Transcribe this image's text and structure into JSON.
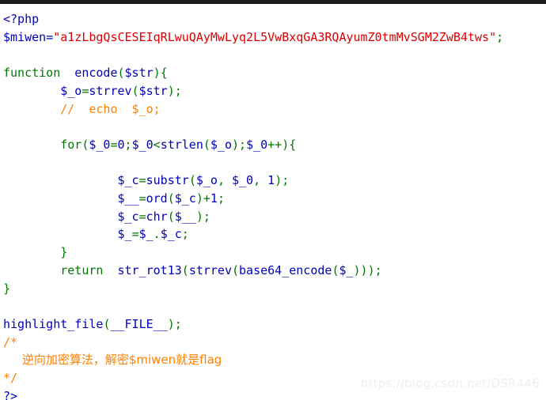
{
  "window": {
    "background_color": "#ffffff",
    "top_strip_color": "#1c1b1c"
  },
  "syntax_colors": {
    "default": "#0000bb",
    "keyword": "#007700",
    "string": "#dd0000",
    "comment": "#ff8000"
  },
  "code": {
    "language": "php",
    "line_01_open_tag": "<?php",
    "line_02_var": "$miwen=",
    "line_02_string": "\"a1zLbgQsCESEIqRLwuQAyMwLyq2L5VwBxqGA3RQAyumZ0tmMvSGM2ZwB4tws\"",
    "line_02_semi": ";",
    "line_04_kw_function": "function",
    "line_04_name": "  encode",
    "line_04_paren_open": "(",
    "line_04_param": "$str",
    "line_04_paren_close": ")",
    "line_04_brace": "{",
    "line_05_var": "        $_o",
    "line_05_eq": "=",
    "line_05_call": "strrev",
    "line_05_paren_open": "(",
    "line_05_arg": "$str",
    "line_05_tail": ");",
    "line_06_comment": "        //  echo  $_o;",
    "line_08_kw_for": "        for",
    "line_08_paren_open": "(",
    "line_08_v1": "$_0",
    "line_08_eq1": "=",
    "line_08_zero": "0",
    "line_08_semi1": ";",
    "line_08_v2": "$_0",
    "line_08_lt": "<",
    "line_08_strlen": "strlen",
    "line_08_p2": "(",
    "line_08_v3": "$_o",
    "line_08_p3": ");",
    "line_08_v4": "$_0",
    "line_08_inc": "++",
    "line_08_p4": ")",
    "line_08_brace": "{",
    "line_10_var": "                $_c",
    "line_10_eq": "=",
    "line_10_call": "substr",
    "line_10_p": "(",
    "line_10_a1": "$_o",
    "line_10_c1": ",",
    "line_10_a2": " $_0",
    "line_10_c2": ",",
    "line_10_num": " 1",
    "line_10_tail": ");",
    "line_11_var": "                $__",
    "line_11_eq": "=",
    "line_11_call": "ord",
    "line_11_p": "(",
    "line_11_a1": "$_c",
    "line_11_pc": ")",
    "line_11_plus": "+",
    "line_11_num": "1",
    "line_11_semi": ";",
    "line_12_var": "                $_c",
    "line_12_eq": "=",
    "line_12_call": "chr",
    "line_12_p": "(",
    "line_12_a1": "$__",
    "line_12_tail": ");",
    "line_13_var": "                $_",
    "line_13_eq": "=",
    "line_13_a1": "$_",
    "line_13_dot": ".",
    "line_13_a2": "$_c",
    "line_13_semi": ";",
    "line_14_brace_close": "        }",
    "line_15_kw_return": "        return",
    "line_15_call1": "  str_rot13",
    "line_15_p1": "(",
    "line_15_call2": "strrev",
    "line_15_p2": "(",
    "line_15_call3": "base64_encode",
    "line_15_p3": "(",
    "line_15_arg": "$_",
    "line_15_tail": ")));",
    "line_16_brace_close": "}",
    "line_18_call": "highlight_file",
    "line_18_p": "(",
    "line_18_const": "__FILE__",
    "line_18_tail": ");",
    "line_19_comment_open": "/*",
    "line_20_comment_cjk": "     逆向加密算法，解密$miwen就是flag",
    "line_21_comment_close": "*/",
    "line_22_close_tag": "?>"
  },
  "watermark": {
    "text": "https://blog.csdn.net/DSR446",
    "color": "#efefef"
  }
}
